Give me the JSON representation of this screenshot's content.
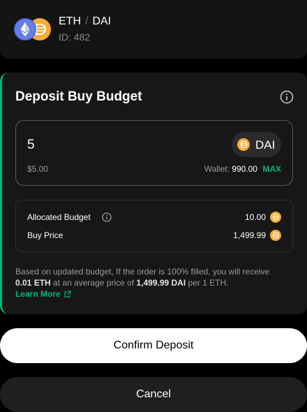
{
  "pair": {
    "base": "ETH",
    "separator": "/",
    "quote": "DAI",
    "id_label": "ID: 482"
  },
  "deposit": {
    "title": "Deposit Buy Budget",
    "amount": "5",
    "token": "DAI",
    "usd_value": "$5.00",
    "wallet_label": "Wallet:",
    "wallet_value": "990.00",
    "max_label": "MAX"
  },
  "summary": {
    "allocated_label": "Allocated Budget",
    "allocated_value": "10.00",
    "price_label": "Buy Price",
    "price_value": "1,499.99"
  },
  "note": {
    "line_a": "Based on updated budget, If the order is 100% filled, you will receive",
    "eth_amount": "0.01 ETH",
    "line_b": "at an average price of",
    "price": "1,499.99 DAI",
    "line_c": "per 1 ETH.",
    "learn_more": "Learn More"
  },
  "buttons": {
    "confirm": "Confirm Deposit",
    "cancel": "Cancel"
  },
  "colors": {
    "accent": "#00b578",
    "eth": "#627eea",
    "dai": "#f5ac37"
  },
  "icons": [
    "eth-icon",
    "dai-icon",
    "info-icon",
    "external-link-icon"
  ]
}
